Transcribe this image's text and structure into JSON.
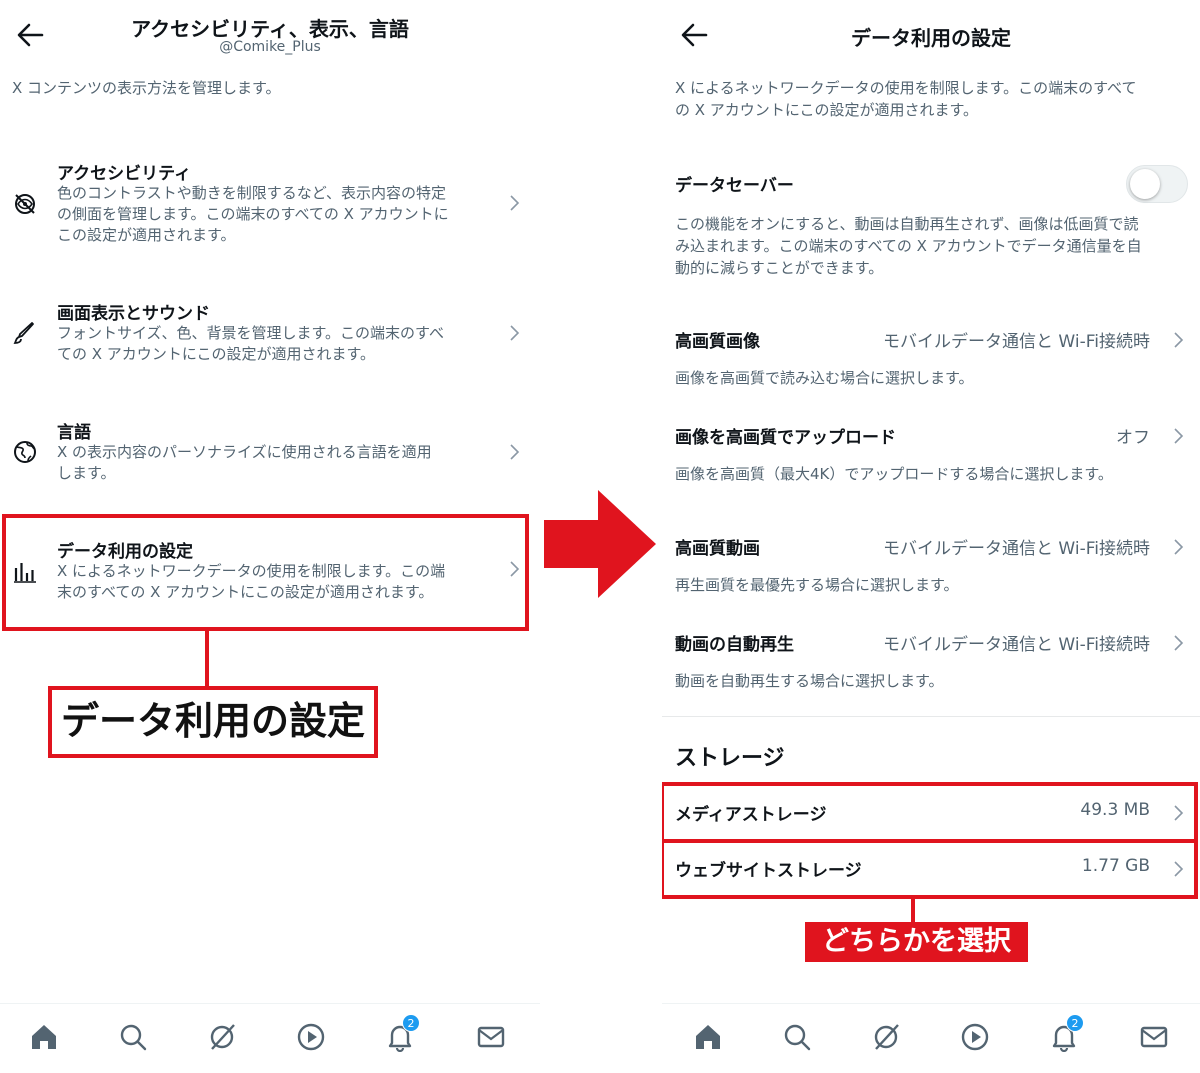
{
  "colors": {
    "accent_red": "#e0141e",
    "muted_text": "#536471",
    "badge_blue": "#1d9bf0"
  },
  "left": {
    "back_icon": "arrow-left-icon",
    "header": {
      "title": "アクセシビリティ、表示、言語",
      "subtitle": "@Comike_Plus"
    },
    "description": "X コンテンツの表示方法を管理します。",
    "items": [
      {
        "icon": "accessibility-icon",
        "title": "アクセシビリティ",
        "lines": [
          "色のコントラストや動きを制限するなど、表示内容の特定",
          "の側面を管理します。この端末のすべての X アカウントに",
          "この設定が適用されます。"
        ]
      },
      {
        "icon": "brush-icon",
        "title": "画面表示とサウンド",
        "lines": [
          "フォントサイズ、色、背景を管理します。この端末のすべ",
          "ての X アカウントにこの設定が適用されます。"
        ]
      },
      {
        "icon": "globe-icon",
        "title": "言語",
        "lines": [
          "X の表示内容のパーソナライズに使用される言語を適用",
          "します。"
        ]
      },
      {
        "icon": "bar-chart-icon",
        "title": "データ利用の設定",
        "lines": [
          "X によるネットワークデータの使用を制限します。この端",
          "末のすべての X アカウントにこの設定が適用されます。"
        ]
      }
    ],
    "callout": "データ利用の設定",
    "nav": {
      "notifications_badge": "2"
    }
  },
  "right": {
    "back_icon": "arrow-left-icon",
    "header": {
      "title": "データ利用の設定"
    },
    "description_lines": [
      "X によるネットワークデータの使用を制限します。この端末のすべて",
      "の X アカウントにこの設定が適用されます。"
    ],
    "data_saver": {
      "title": "データセーバー",
      "enabled": false,
      "lines": [
        "この機能をオンにすると、動画は自動再生されず、画像は低画質で読",
        "み込まれます。この端末のすべての X アカウントでデータ通信量を自",
        "動的に減らすことができます。"
      ]
    },
    "settings": [
      {
        "title": "高画質画像",
        "value": "モバイルデータ通信と Wi-Fi接続時",
        "sub": "画像を高画質で読み込む場合に選択します。"
      },
      {
        "title": "画像を高画質でアップロード",
        "value": "オフ",
        "sub": "画像を高画質（最大4K）でアップロードする場合に選択します。"
      },
      {
        "title": "高画質動画",
        "value": "モバイルデータ通信と Wi-Fi接続時",
        "sub": "再生画質を最優先する場合に選択します。"
      },
      {
        "title": "動画の自動再生",
        "value": "モバイルデータ通信と Wi-Fi接続時",
        "sub": "動画を自動再生する場合に選択します。"
      }
    ],
    "storage": {
      "title": "ストレージ",
      "items": [
        {
          "title": "メディアストレージ",
          "value": "49.3 MB"
        },
        {
          "title": "ウェブサイトストレージ",
          "value": "1.77 GB"
        }
      ]
    },
    "callout": "どちらかを選択",
    "nav": {
      "notifications_badge": "2"
    }
  }
}
